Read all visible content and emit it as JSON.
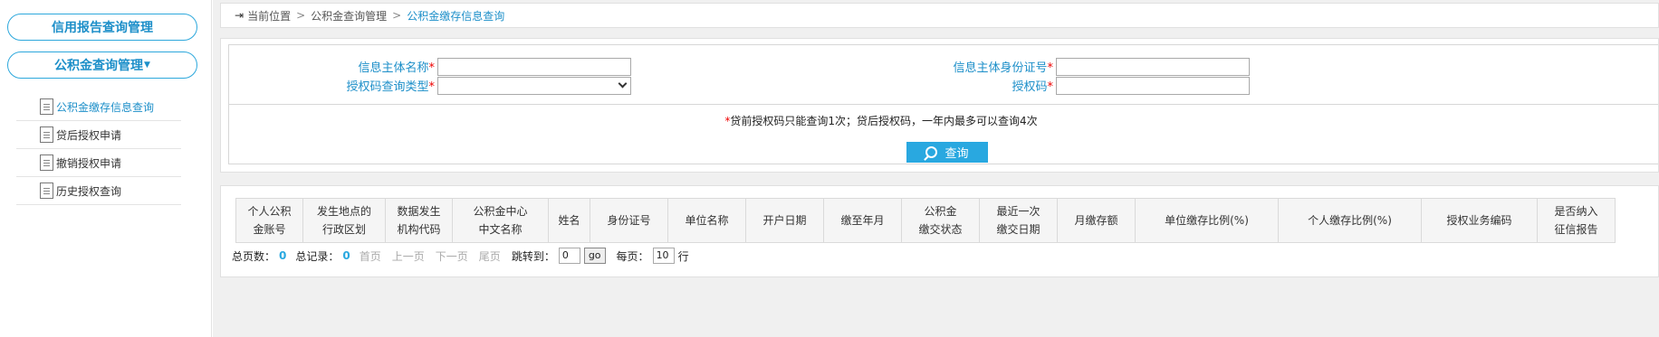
{
  "sidebar": {
    "menu1": "信用报告查询管理",
    "menu2": "公积金查询管理",
    "items": [
      {
        "label": "公积金缴存信息查询"
      },
      {
        "label": "贷后授权申请"
      },
      {
        "label": "撤销授权申请"
      },
      {
        "label": "历史授权查询"
      }
    ]
  },
  "breadcrumb": {
    "home": "当前位置",
    "level1": "公积金查询管理",
    "current": "公积金缴存信息查询"
  },
  "form": {
    "name_label": "信息主体名称",
    "id_label": "信息主体身份证号",
    "type_label": "授权码查询类型",
    "code_label": "授权码",
    "required_mark": "*",
    "name_value": "",
    "id_value": "",
    "type_value": "",
    "code_value": "",
    "notice_mark": "*",
    "notice": "贷前授权码只能查询1次；贷后授权码，一年内最多可以查询4次",
    "search_label": "查询"
  },
  "table": {
    "headers": [
      [
        "个人公积",
        "金账号"
      ],
      [
        "发生地点的",
        "行政区划"
      ],
      [
        "数据发生",
        "机构代码"
      ],
      [
        "公积金中心",
        "中文名称"
      ],
      [
        "姓名"
      ],
      [
        "身份证号"
      ],
      [
        "单位名称"
      ],
      [
        "开户日期"
      ],
      [
        "缴至年月"
      ],
      [
        "公积金",
        "缴交状态"
      ],
      [
        "最近一次",
        "缴交日期"
      ],
      [
        "月缴存额"
      ],
      [
        "单位缴存比例(%)"
      ],
      [
        "个人缴存比例(%)"
      ],
      [
        "授权业务编码"
      ],
      [
        "是否纳入",
        "征信报告"
      ]
    ]
  },
  "pager": {
    "total_pages_label": "总页数：",
    "total_pages": "0",
    "total_records_label": "总记录：",
    "total_records": "0",
    "first": "首页",
    "prev": "上一页",
    "next": "下一页",
    "last": "尾页",
    "jump_label": "跳转到：",
    "jump_value": "0",
    "go": "go",
    "per_page_label": "每页：",
    "per_page_value": "10",
    "per_page_unit": "行"
  },
  "colors": {
    "accent": "#1d8fc9",
    "button": "#29a8e0",
    "required": "#ee0000"
  },
  "icons": {
    "breadcrumb": "exit-door-icon",
    "menu_item": "document-icon",
    "search": "magnifier-icon",
    "dropdown": "chevron-down-icon"
  }
}
